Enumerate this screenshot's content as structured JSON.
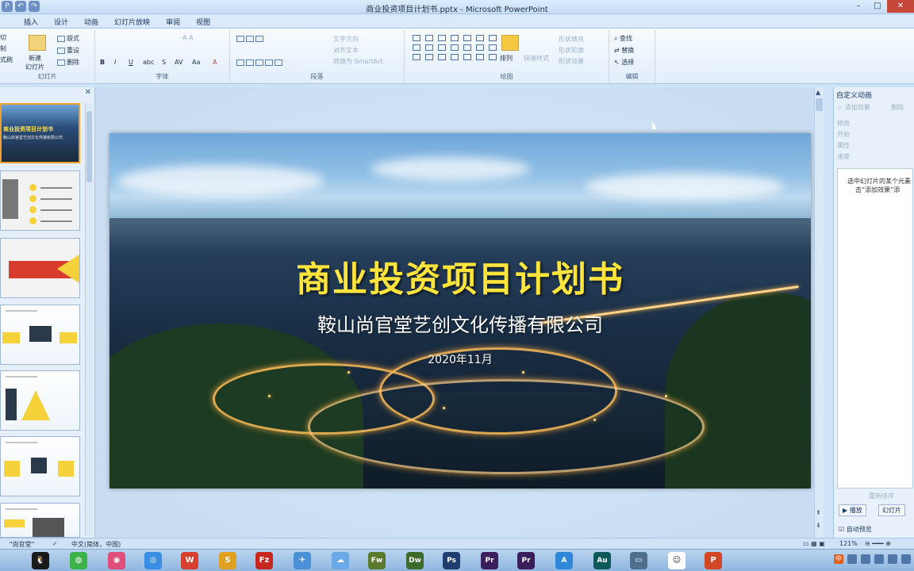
{
  "window": {
    "title": "商业投资项目计划书.pptx - Microsoft PowerPoint",
    "controls": {
      "minimize": "–",
      "maximize": "□",
      "close": "✕"
    }
  },
  "ribbon": {
    "tabs": [
      "插入",
      "设计",
      "动画",
      "幻灯片放映",
      "审阅",
      "视图"
    ],
    "slides_group": {
      "label": "幻灯片",
      "new_slide": "新建\n幻灯片",
      "layout": "版式",
      "reset": "重设",
      "delete": "删除",
      "left_items": [
        "切",
        "制",
        "式刷"
      ]
    },
    "font_group": {
      "label": "字体"
    },
    "paragraph_group": {
      "label": "段落",
      "text_direction": "文字方向",
      "align_text": "对齐文本",
      "smartart": "转换为 SmartArt"
    },
    "drawing_group": {
      "label": "绘图",
      "arrange": "排列",
      "quick_styles": "快速样式",
      "shape_fill": "形状填充",
      "shape_outline": "形状轮廓",
      "shape_effects": "形状效果"
    },
    "editing_group": {
      "label": "编辑",
      "find": "查找",
      "replace": "替换",
      "select": "选择"
    }
  },
  "slide": {
    "title": "商业投资项目计划书",
    "subtitle": "鞍山尚官堂艺创文化传播有限公司",
    "date": "2020年11月"
  },
  "thumbnails": [
    {
      "title": "商业投资项目计划书",
      "subtitle": "鞍山尚官堂艺创文化传播有限公司",
      "selected": true
    },
    {
      "items": [
        "请输入文本内容",
        "请输入文本内容",
        "请输入文本内容",
        "请输入文本内容"
      ]
    },
    {
      "label": "请输入您的标题"
    },
    {
      "label": "请输入您的标题",
      "value": "70%"
    },
    {
      "label": "请输入您的标题",
      "value": "60%"
    },
    {
      "label": "请输入您的标题"
    },
    {
      "label": "请输入您的标题"
    }
  ],
  "task_pane": {
    "title": "自定义动画",
    "add_effect": "添加效果",
    "remove": "删除",
    "modify_label": "修改",
    "start": "开始",
    "property": "属性",
    "speed": "速度",
    "hint_line1": "选中幻灯片的某个元素",
    "hint_line2": "击“添加效果”添",
    "reorder": "重新排序",
    "play": "▶ 播放",
    "slideshow": "幻灯片",
    "autopreview": "自动预览"
  },
  "statusbar": {
    "theme": "\"尚官堂\"",
    "language": "中文(简体，中国)",
    "zoom": "121%"
  },
  "taskbar": {
    "apps": [
      "QQ",
      "微信",
      "浏览器",
      "Chrome",
      "WPS",
      "Sublime",
      "FileZilla",
      "Feiq",
      "百度网盘",
      "Fw",
      "Dw",
      "Ps",
      "Pr",
      "Pr",
      "A",
      "Au",
      "远程",
      "用户",
      "PPT"
    ],
    "ime": "中"
  },
  "colors": {
    "title_yellow": "#ffe53b",
    "accent_blue": "#6b8fc6",
    "selected_border": "#f0a030"
  }
}
